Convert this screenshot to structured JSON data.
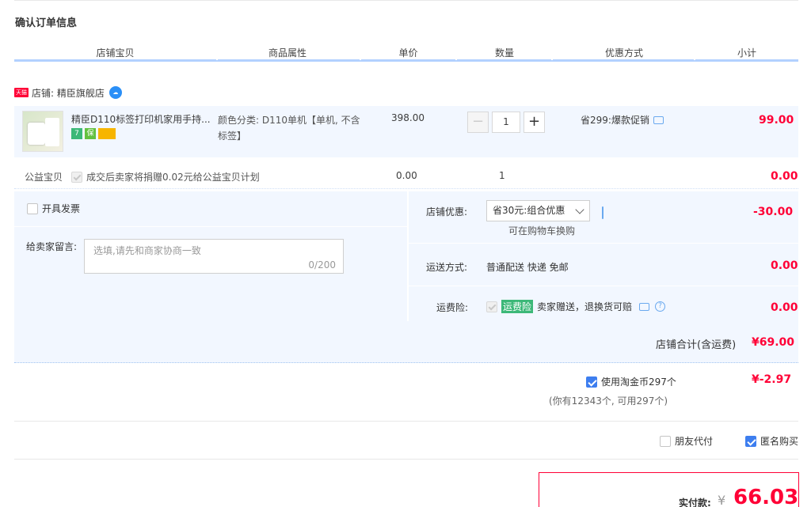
{
  "page_title": "确认订单信息",
  "table_headers": [
    "店铺宝贝",
    "商品属性",
    "单价",
    "数量",
    "优惠方式",
    "小计"
  ],
  "shop": {
    "badge": "天猫",
    "name": "店铺: 精臣旗舰店",
    "chat_icon": "wangwang-icon"
  },
  "item": {
    "name": "精臣D110标签打印机家用手持...",
    "attr": "颜色分类: D110单机【单机, 不含标签】",
    "price": "398.00",
    "quantity": "1",
    "minus": "−",
    "plus": "+",
    "promo": "省299:爆款促销",
    "subtotal": "99.00",
    "badges": [
      "7",
      "保",
      ""
    ]
  },
  "charity": {
    "label": "公益宝贝",
    "text": "成交后卖家将捐赠0.02元给公益宝贝计划",
    "price": "0.00",
    "quantity": "1",
    "subtotal": "0.00"
  },
  "invoice": {
    "label": "开具发票"
  },
  "message": {
    "label": "给卖家留言:",
    "placeholder": "选填,请先和商家协商一致",
    "count": "0/200"
  },
  "shop_discount": {
    "label": "店铺优惠:",
    "selected": "省30元:组合优惠",
    "note": "可在购物车换购",
    "amount": "-30.00"
  },
  "shipping": {
    "label": "运送方式:",
    "value": "普通配送 快递 免邮",
    "amount": "0.00"
  },
  "insurance": {
    "label": "运费险:",
    "tag": "运费险",
    "text": "卖家赠送，退换货可赔",
    "amount": "0.00"
  },
  "shop_total": {
    "label": "店铺合计(含运费)",
    "amount": "¥69.00"
  },
  "coins": {
    "label": "使用淘金币297个",
    "amount": "¥-2.97",
    "note": "(你有12343个, 可用297个)"
  },
  "options": {
    "friend_pay": "朋友代付",
    "anonymous": "匿名购买"
  },
  "payment": {
    "label": "实付款:",
    "currency": "¥",
    "amount": "66.03"
  },
  "colors": {
    "accent_red": "#ff0036",
    "light_blue": "#f2f7ff",
    "check_blue": "#3d7eef"
  }
}
